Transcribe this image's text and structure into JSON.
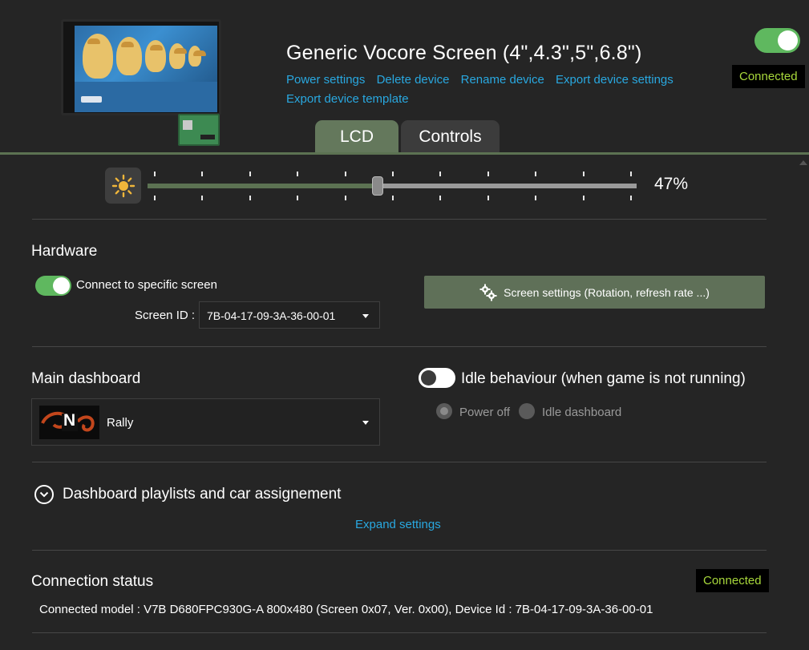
{
  "header": {
    "title": "Generic Vocore Screen (4\",4.3\",5\",6.8\")",
    "links": [
      "Power settings",
      "Delete device",
      "Rename device",
      "Export device settings",
      "Export device template"
    ],
    "enabled": true,
    "status": "Connected"
  },
  "tabs": [
    {
      "label": "LCD",
      "selected": true
    },
    {
      "label": "Controls",
      "selected": false
    }
  ],
  "brightness": {
    "value_label": "47%",
    "value": 0.47
  },
  "hardware": {
    "title": "Hardware",
    "connect_specific_label": "Connect to specific screen",
    "connect_specific": true,
    "screen_id_label": "Screen ID :",
    "screen_id_value": "7B-04-17-09-3A-36-00-01",
    "screen_settings_button": "Screen settings (Rotation, refresh rate ...)"
  },
  "dashboard": {
    "title": "Main dashboard",
    "selected_dashboard": "Rally",
    "thumbnail_gear": "N",
    "idle_label": "Idle behaviour (when game is not running)",
    "idle_enabled": false,
    "idle_options": [
      {
        "label": "Power off",
        "checked": true
      },
      {
        "label": "Idle dashboard",
        "checked": false
      }
    ]
  },
  "playlists": {
    "title": "Dashboard playlists and car assignement",
    "expand_label": "Expand settings"
  },
  "connection": {
    "title": "Connection status",
    "status": "Connected",
    "details": "Connected model : V7B D680FPC930G-A 800x480 (Screen 0x07, Ver. 0x00), Device Id : 7B-04-17-09-3A-36-00-01"
  },
  "colors": {
    "accent_green": "#5fb85f",
    "tab_selected": "#64785c",
    "link_blue": "#29a8e0",
    "status_text": "#a8d83b"
  }
}
